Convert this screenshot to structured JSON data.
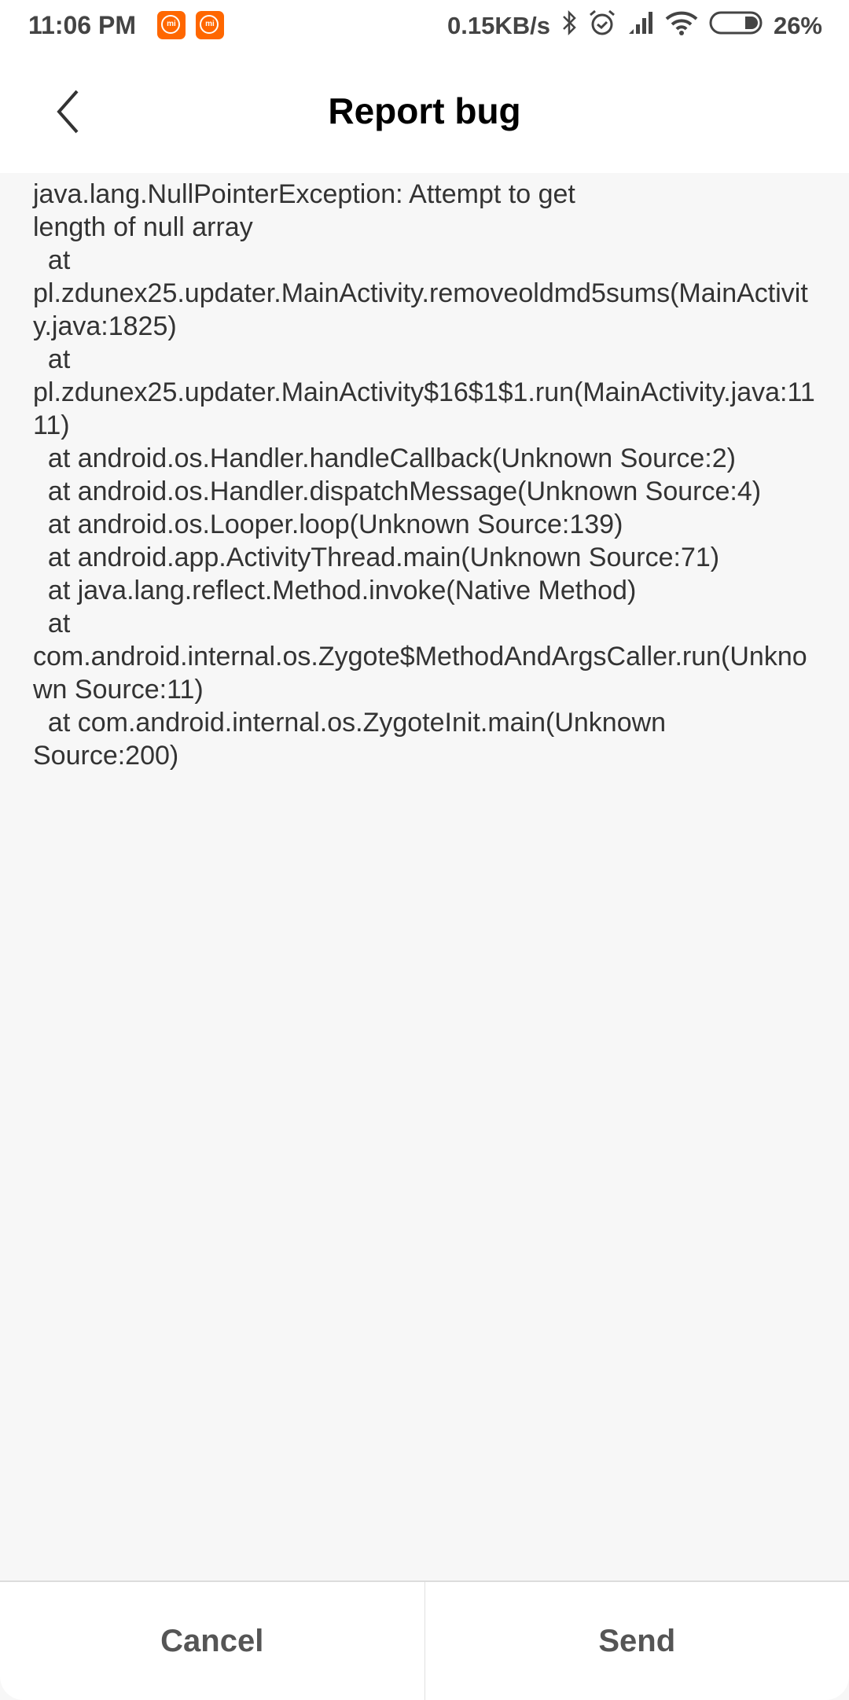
{
  "status_bar": {
    "time": "11:06 PM",
    "notification_icons": [
      "mi-app-icon",
      "mi-app-icon"
    ],
    "network_speed": "0.15KB/s",
    "icons": [
      "bluetooth-icon",
      "alarm-icon",
      "signal-icon",
      "wifi-icon",
      "battery-icon"
    ],
    "battery_percent": "26%",
    "battery_level": 0.26
  },
  "header": {
    "title": "Report bug",
    "back_icon": "chevron-left-icon"
  },
  "report": {
    "stack_trace": "java.lang.NullPointerException: Attempt to get\nlength of null array\n  at\npl.zdunex25.updater.MainActivity.removeoldmd5sums(MainActivity.java:1825)\n  at\npl.zdunex25.updater.MainActivity$16$1$1.run(MainActivity.java:1111)\n  at android.os.Handler.handleCallback(Unknown Source:2)\n  at android.os.Handler.dispatchMessage(Unknown Source:4)\n  at android.os.Looper.loop(Unknown Source:139)\n  at android.app.ActivityThread.main(Unknown Source:71)\n  at java.lang.reflect.Method.invoke(Native Method)\n  at\ncom.android.internal.os.Zygote$MethodAndArgsCaller.run(Unknown Source:11)\n  at com.android.internal.os.ZygoteInit.main(Unknown\nSource:200)"
  },
  "actions": {
    "cancel_label": "Cancel",
    "send_label": "Send"
  },
  "colors": {
    "mi_orange": "#ff6700",
    "background": "#f7f7f7",
    "text": "#333333"
  }
}
